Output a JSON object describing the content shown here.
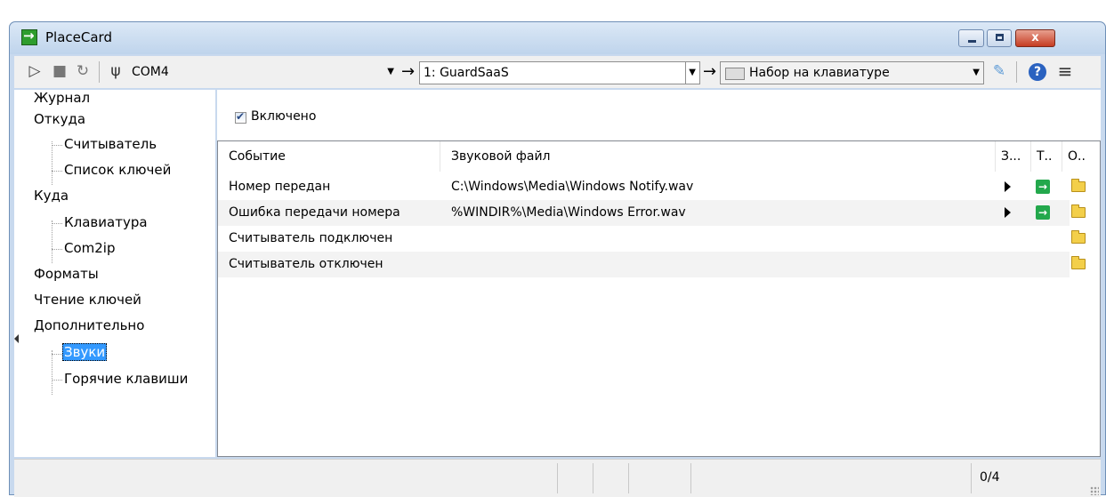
{
  "window": {
    "title": "PlaceCard",
    "close_glyph": "x"
  },
  "toolbar": {
    "port_value": "COM4",
    "device_value": "1: GuardSaaS",
    "output_value": "Набор на клавиатуре",
    "arrow_glyph": "→"
  },
  "sidebar": {
    "items": [
      {
        "label": "Журнал"
      },
      {
        "label": "Откуда"
      },
      {
        "label": "Считыватель"
      },
      {
        "label": "Список ключей"
      },
      {
        "label": "Куда"
      },
      {
        "label": "Клавиатура"
      },
      {
        "label": "Com2ip"
      },
      {
        "label": "Форматы"
      },
      {
        "label": "Чтение ключей"
      },
      {
        "label": "Дополнительно"
      },
      {
        "label": "Звуки"
      },
      {
        "label": "Горячие клавиши"
      }
    ],
    "selected": "Звуки"
  },
  "main": {
    "enabled_label": "Включено",
    "enabled_checked": true,
    "columns": [
      "Событие",
      "Звуковой файл",
      "З...",
      "Т..",
      "О.."
    ],
    "rows": [
      {
        "event": "Номер передан",
        "file": "C:\\Windows\\Media\\Windows Notify.wav",
        "play": true,
        "test": true,
        "open": true
      },
      {
        "event": "Ошибка передачи номера",
        "file": "%WINDIR%\\Media\\Windows Error.wav",
        "play": true,
        "test": true,
        "open": true
      },
      {
        "event": "Считыватель подключен",
        "file": "",
        "play": false,
        "test": false,
        "open": true
      },
      {
        "event": "Считыватель отключен",
        "file": "",
        "play": false,
        "test": false,
        "open": true
      }
    ]
  },
  "status": {
    "counter": "0/4"
  },
  "colors": {
    "accent": "#3399ff",
    "titlebar": "#c8d9ee",
    "close": "#c53c22",
    "go": "#23a84c",
    "folder": "#f3cf4a"
  }
}
